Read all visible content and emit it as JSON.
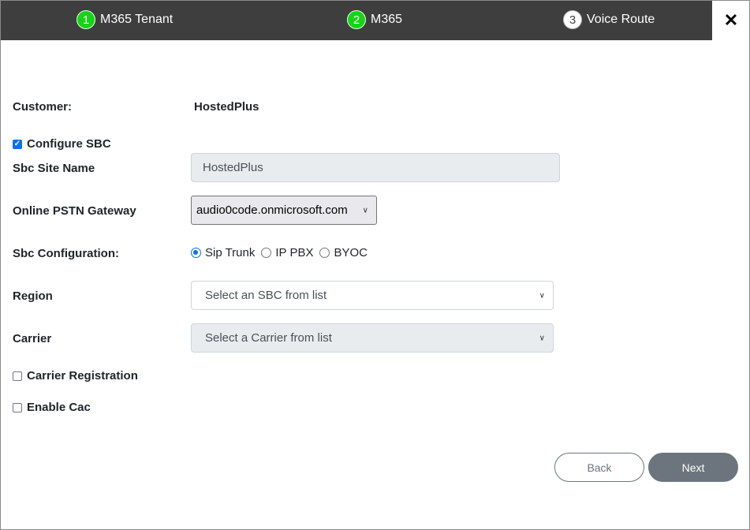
{
  "wizard": {
    "steps": [
      {
        "number": "1",
        "label": "M365 Tenant",
        "state": "done"
      },
      {
        "number": "2",
        "label": "M365",
        "state": "done"
      },
      {
        "number": "3",
        "label": "Voice Route",
        "state": "current"
      }
    ],
    "close_glyph": "✕"
  },
  "form": {
    "customer_label": "Customer:",
    "customer_value": "HostedPlus",
    "configure_sbc_label": "Configure SBC",
    "configure_sbc_checked": true,
    "sbc_site_name_label": "Sbc Site Name",
    "sbc_site_name_value": "HostedPlus",
    "pstn_gateway_label": "Online PSTN Gateway",
    "pstn_gateway_value": "audio0code.onmicrosoft.com",
    "sbc_config_label": "Sbc Configuration:",
    "sbc_config_options": [
      "Sip Trunk",
      "IP PBX",
      "BYOC"
    ],
    "sbc_config_selected": "Sip Trunk",
    "region_label": "Region",
    "region_placeholder": "Select an SBC from list",
    "carrier_label": "Carrier",
    "carrier_placeholder": "Select a Carrier from list",
    "carrier_registration_label": "Carrier Registration",
    "carrier_registration_checked": false,
    "enable_cac_label": "Enable Cac",
    "enable_cac_checked": false
  },
  "buttons": {
    "back": "Back",
    "next": "Next"
  },
  "colors": {
    "header_bg": "#3e3e3e",
    "step_done": "#15d415",
    "accent": "#0d6efd",
    "next_bg": "#6c757d"
  }
}
